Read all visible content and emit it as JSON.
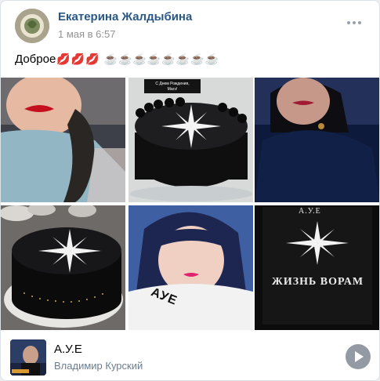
{
  "post": {
    "author": "Екатерина Жалдыбина",
    "date": "1 мая в 6:57",
    "text": "Доброе",
    "emojis": {
      "lips": [
        "💋",
        "💋",
        "💋"
      ],
      "cups": [
        "☕",
        "☕",
        "☕",
        "☕",
        "☕",
        "☕",
        "☕",
        "☕"
      ]
    }
  },
  "photos": {
    "cake_top_label": "С Днем Рождения,\nМагэ!",
    "p5_caption": "АУЕ",
    "p6_top_label": "А.У.Е",
    "p6_caption": "ЖИЗНЬ ВОРАМ"
  },
  "audio": {
    "title": "А.У.Е",
    "artist": "Владимир Курский"
  },
  "colors": {
    "author_link": "#2a5885",
    "meta_gray": "#939393",
    "artist_gray": "#6c7d8f",
    "play_button": "#939aa3"
  }
}
